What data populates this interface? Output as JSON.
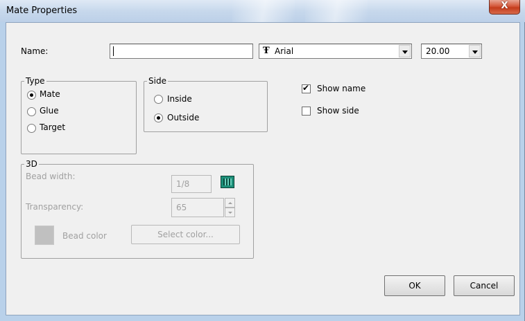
{
  "window": {
    "title": "Mate Properties",
    "close_glyph": "X"
  },
  "name_field": {
    "label": "Name:",
    "value": ""
  },
  "font_select": {
    "icon": "font-icon",
    "icon_glyph": "Ŧ",
    "value": "Arial"
  },
  "size_select": {
    "value": "20.00"
  },
  "type_group": {
    "title": "Type",
    "options": [
      {
        "label": "Mate",
        "selected": true
      },
      {
        "label": "Glue",
        "selected": false
      },
      {
        "label": "Target",
        "selected": false
      }
    ]
  },
  "side_group": {
    "title": "Side",
    "options": [
      {
        "label": "Inside",
        "selected": false
      },
      {
        "label": "Outside",
        "selected": true
      }
    ]
  },
  "checkboxes": {
    "show_name": {
      "label": "Show name",
      "checked": true
    },
    "show_side": {
      "label": "Show side",
      "checked": false
    }
  },
  "group_3d": {
    "title": "3D",
    "bead_width_label": "Bead width:",
    "bead_width_value": "1/8",
    "transparency_label": "Transparency:",
    "transparency_value": "65",
    "bead_color_label": "Bead color",
    "select_color_button": "Select color...",
    "bead_color": "#c0c0c0"
  },
  "buttons": {
    "ok": "OK",
    "cancel": "Cancel"
  },
  "colors": {
    "title_bar": "#c7d8ec",
    "close_button": "#d4583a",
    "dialog_bg": "#f0f0f0"
  }
}
